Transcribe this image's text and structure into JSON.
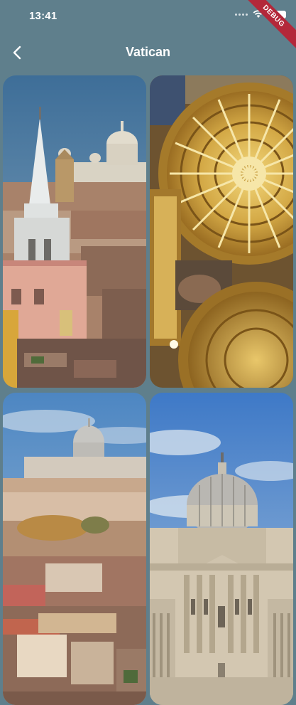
{
  "status_bar": {
    "time": "13:41"
  },
  "debug_banner": "DEBUG",
  "app_bar": {
    "title": "Vatican"
  },
  "gallery": {
    "photos": [
      {
        "subject": "Rome skyline with church spire and St. Peter's dome"
      },
      {
        "subject": "Gilded coffered dome ceiling"
      },
      {
        "subject": "Rome rooftops toward St. Peter's Basilica"
      },
      {
        "subject": "St. Peter's Basilica facade and dome"
      }
    ]
  }
}
